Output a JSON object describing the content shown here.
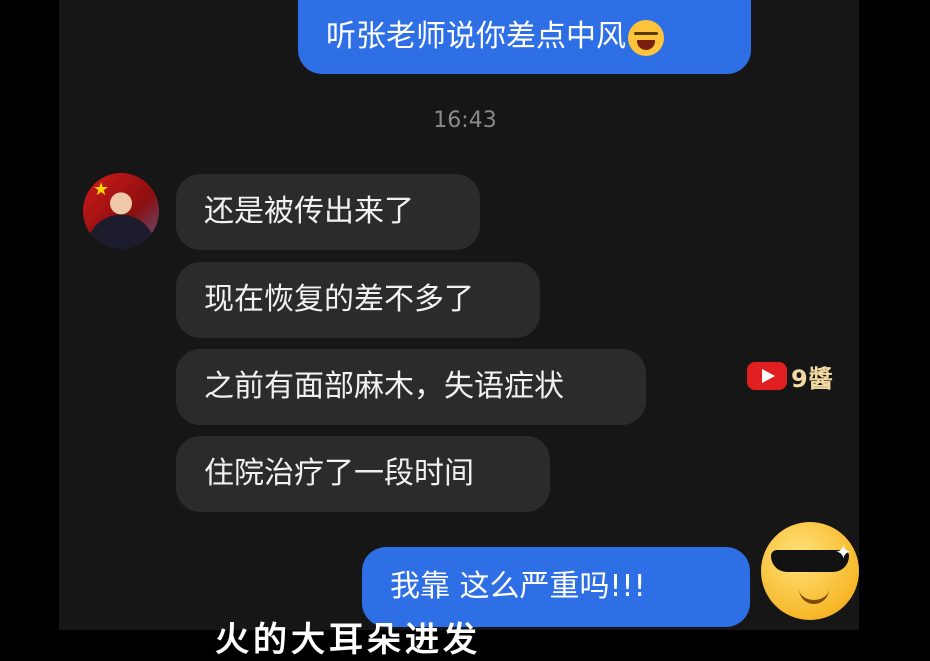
{
  "messages": {
    "sent_top": "听张老师说你差点中风",
    "time": "16:43",
    "recv": [
      "还是被传出来了",
      "现在恢复的差不多了",
      "之前有面部麻木，失语症状",
      "住院治疗了一段时间"
    ],
    "sent_bottom": "我靠 这么严重吗!!!"
  },
  "watermark": {
    "text": "9醬"
  },
  "subtitle": {
    "text": "火的大耳朵进发"
  },
  "colors": {
    "sent": "#2f6fe6",
    "received": "#2b2b2b",
    "background": "#161616"
  }
}
